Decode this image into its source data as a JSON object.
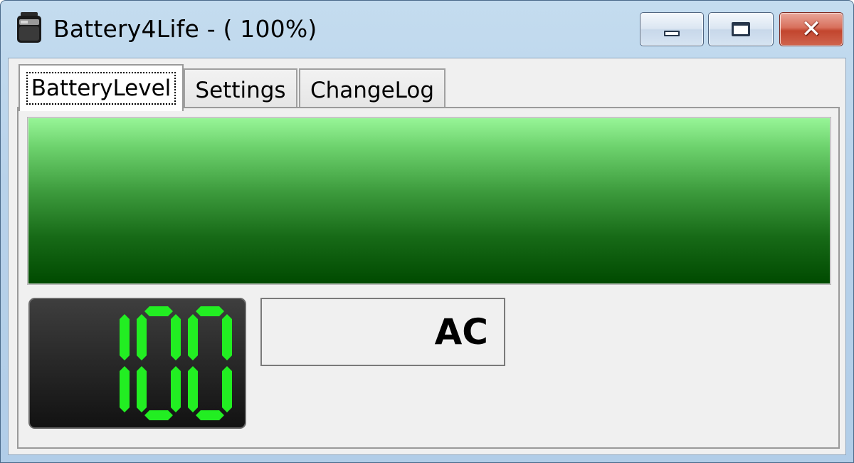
{
  "window": {
    "title": "Battery4Life - ( 100%)",
    "app_icon": "battery-icon"
  },
  "caption_buttons": {
    "minimize_icon": "minimize-icon",
    "maximize_icon": "maximize-icon",
    "close_icon": "close-icon",
    "close_glyph": "✕"
  },
  "tabs": [
    {
      "label": "BatteryLevel",
      "active": true
    },
    {
      "label": "Settings",
      "active": false
    },
    {
      "label": "ChangeLog",
      "active": false
    }
  ],
  "battery": {
    "level_percent": 100,
    "digits": "100",
    "power_source": "AC",
    "bar_color": "#0a5e0a",
    "digit_color": "#22ee22"
  }
}
